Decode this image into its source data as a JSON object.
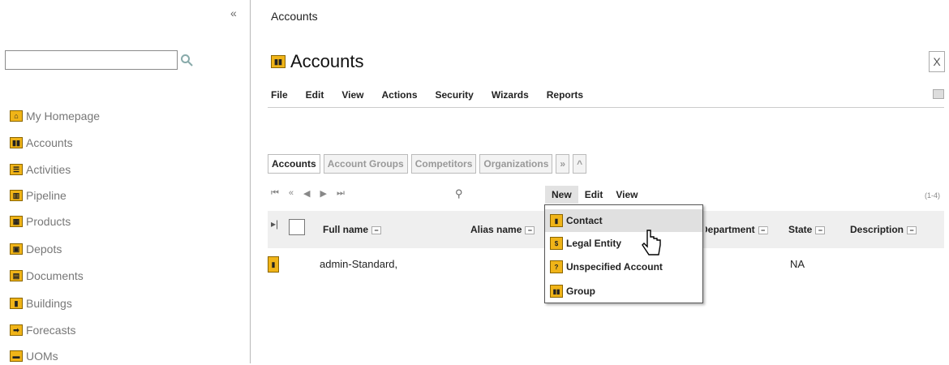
{
  "sidebar": {
    "collapse_label": "«",
    "search": {
      "value": "",
      "placeholder": ""
    },
    "items": [
      {
        "label": "My Homepage",
        "icon": "home-icon"
      },
      {
        "label": "Accounts",
        "icon": "accounts-icon"
      },
      {
        "label": "Activities",
        "icon": "activities-icon"
      },
      {
        "label": "Pipeline",
        "icon": "pipeline-icon"
      },
      {
        "label": "Products",
        "icon": "products-icon"
      },
      {
        "label": "Depots",
        "icon": "depots-icon"
      },
      {
        "label": "Documents",
        "icon": "documents-icon"
      },
      {
        "label": "Buildings",
        "icon": "buildings-icon"
      },
      {
        "label": "Forecasts",
        "icon": "forecasts-icon"
      },
      {
        "label": "UOMs",
        "icon": "uoms-icon"
      }
    ]
  },
  "main": {
    "breadcrumb": "Accounts",
    "title": "Accounts",
    "close_label": "X",
    "menu": [
      "File",
      "Edit",
      "View",
      "Actions",
      "Security",
      "Wizards",
      "Reports"
    ],
    "tabs": [
      "Accounts",
      "Account Groups",
      "Competitors",
      "Organizations",
      "»",
      "^"
    ],
    "grid_menu": [
      "New",
      "Edit",
      "View"
    ],
    "range": "(1-4)",
    "columns": [
      "Full name",
      "Alias name",
      "Department",
      "State",
      "Description"
    ],
    "rows": [
      {
        "full_name": "admin-Standard,",
        "state": "NA"
      }
    ],
    "new_menu": [
      "Contact",
      "Legal Entity",
      "Unspecified Account",
      "Group"
    ]
  }
}
